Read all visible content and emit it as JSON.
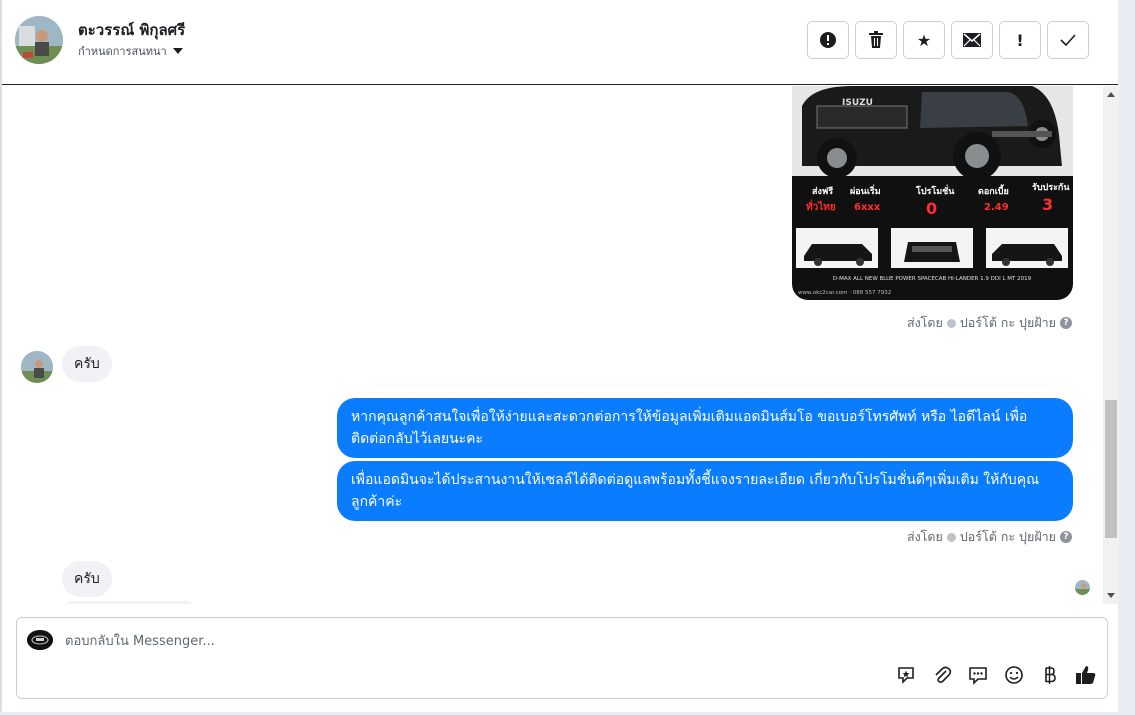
{
  "header": {
    "name": "ตะวรรณ์ พิกุลศรี",
    "subtitle": "กำหนดการสนทนา",
    "actions": [
      {
        "id": "report",
        "icon": "alert-circle-icon",
        "glyph": "!"
      },
      {
        "id": "delete",
        "icon": "trash-icon",
        "glyph": ""
      },
      {
        "id": "star",
        "icon": "star-icon",
        "glyph": "★"
      },
      {
        "id": "mail",
        "icon": "envelope-icon",
        "glyph": "✉"
      },
      {
        "id": "important",
        "icon": "exclamation-icon",
        "glyph": "!"
      },
      {
        "id": "done",
        "icon": "check-icon",
        "glyph": "✓"
      }
    ]
  },
  "promo": {
    "brand": "ISUZU",
    "features": [
      {
        "label": "ส่งฟรี",
        "value": "ทั่วไทย"
      },
      {
        "label": "ผ่อนเริ่ม",
        "value": "6xxx"
      },
      {
        "label": "โปรโมชั่น",
        "value": "0"
      },
      {
        "label": "ดอกเบี้ย",
        "value": "2.49"
      },
      {
        "label": "รับประกัน",
        "value": "3"
      }
    ],
    "model": "D-MAX ALL NEW BLUE POWER SPACECAB HI-LANDER 1.9 DDI L MT 2019",
    "footer": "www.okc2car.com · 088 557 7932"
  },
  "messages": {
    "sent_by_1": "ส่งโดย",
    "sender_1": "ปอร์โต้ กะ ปุยฝ้าย",
    "in_1": "ครับ",
    "out_1": "หากคุณลูกค้าสนใจเพื่อให้ง่ายและสะดวกต่อการให้ข้อมูลเพิ่มเติมแอดมินส์มโอ ขอเบอร์โทรศัพท์ หรือ ไอดีไลน์ เพื่อติดต่อกลับไว้เลยนะคะ",
    "out_2": "เพื่อแอดมินจะได้ประสานงานให้เซลล์ได้ติดต่อดูแลพร้อมทั้งชี้แจงรายละเอียด เกี่ยวกับโปรโมชั่นดีๆเพิ่มเติม ให้กับคุณลูกค้าค่ะ",
    "sent_by_2": "ส่งโดย",
    "sender_2": "ปอร์โต้ กะ ปุยฝ้าย",
    "in_2": "ครับ"
  },
  "composer": {
    "placeholder": "ตอบกลับใน Messenger...",
    "tools": [
      "sticker-icon",
      "paperclip-icon",
      "chat-bubble-icon",
      "emoji-icon",
      "baht-icon",
      "thumbs-up-icon"
    ]
  }
}
